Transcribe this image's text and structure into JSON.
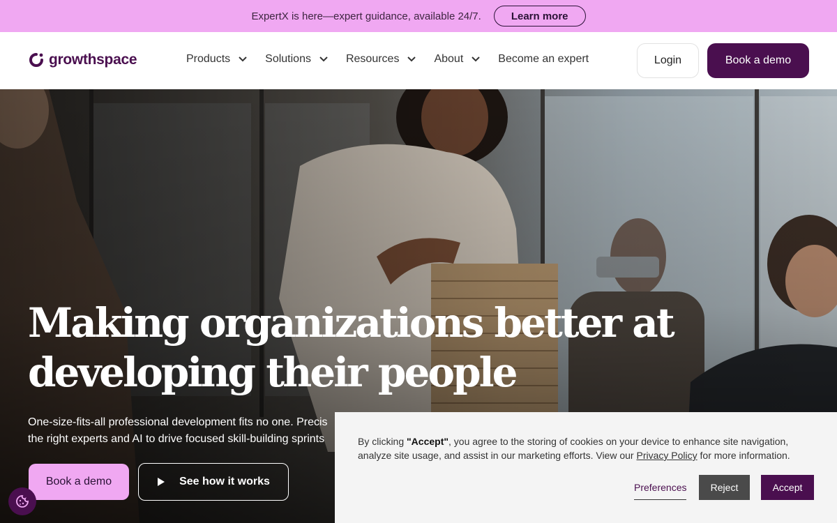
{
  "announcement": {
    "text": "ExpertX is here—expert guidance, available 24/7.",
    "button_label": "Learn more"
  },
  "header": {
    "logo_text": "growthspace",
    "nav": [
      {
        "label": "Products",
        "has_dropdown": true
      },
      {
        "label": "Solutions",
        "has_dropdown": true
      },
      {
        "label": "Resources",
        "has_dropdown": true
      },
      {
        "label": "About",
        "has_dropdown": true
      },
      {
        "label": "Become an expert",
        "has_dropdown": false
      }
    ],
    "login_label": "Login",
    "demo_label": "Book a demo"
  },
  "hero": {
    "title_line1": "Making organizations better at",
    "title_line2": "developing their people",
    "subtitle_line1": "One-size-fits-all professional development fits no one. Precis",
    "subtitle_line2": "the right experts and AI to drive focused skill-building sprints",
    "demo_label": "Book a demo",
    "how_label": "See how it works"
  },
  "cookie_banner": {
    "text_prefix": "By clicking ",
    "text_bold": "\"Accept\"",
    "text_middle": ", you agree to the storing of cookies on your device to enhance site navigation, analyze site usage, and assist in our marketing efforts. View our ",
    "link_label": "Privacy Policy",
    "text_suffix": " for more information.",
    "preferences_label": "Preferences",
    "reject_label": "Reject",
    "accept_label": "Accept"
  },
  "icons": {
    "logo": "growthspace-logo-icon",
    "chevron": "chevron-down-icon",
    "play": "play-icon",
    "cookie": "cookie-icon"
  },
  "colors": {
    "brand": "#4a0f4f",
    "accent_pink": "#f0a8f2",
    "banner_bg": "#f4f4f4"
  }
}
